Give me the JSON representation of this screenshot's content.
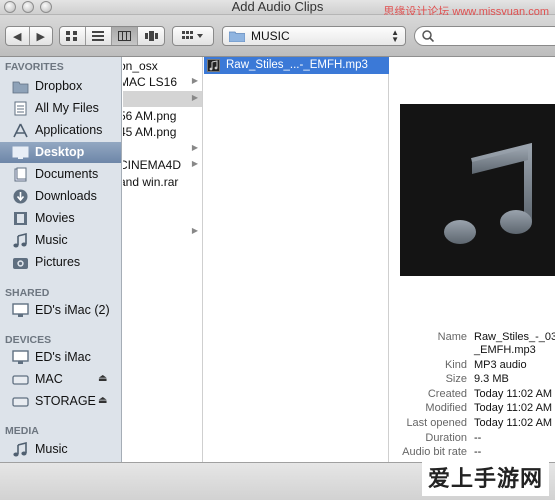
{
  "window": {
    "title": "Add Audio Clips",
    "watermark_top": "思缘设计论坛 www.missyuan.com"
  },
  "toolbar": {
    "back_glyph": "◀",
    "forward_glyph": "▶",
    "path_popup_label": "MUSIC",
    "search_placeholder": ""
  },
  "sidebar": {
    "favorites_header": "FAVORITES",
    "favorites": [
      {
        "label": "Dropbox",
        "icon": "folder-icon"
      },
      {
        "label": "All My Files",
        "icon": "all-files-icon"
      },
      {
        "label": "Applications",
        "icon": "applications-icon"
      },
      {
        "label": "Desktop",
        "icon": "desktop-icon",
        "selected": true
      },
      {
        "label": "Documents",
        "icon": "documents-icon"
      },
      {
        "label": "Downloads",
        "icon": "downloads-icon"
      },
      {
        "label": "Movies",
        "icon": "movies-icon"
      },
      {
        "label": "Music",
        "icon": "music-icon"
      },
      {
        "label": "Pictures",
        "icon": "pictures-icon"
      }
    ],
    "shared_header": "SHARED",
    "shared": [
      {
        "label": "ED's iMac (2)",
        "icon": "computer-icon"
      }
    ],
    "devices_header": "DEVICES",
    "devices": [
      {
        "label": "ED's iMac",
        "icon": "computer-icon"
      },
      {
        "label": "MAC",
        "icon": "drive-icon",
        "eject": true
      },
      {
        "label": "STORAGE",
        "icon": "drive-icon",
        "eject": true
      }
    ],
    "media_header": "MEDIA",
    "media": [
      {
        "label": "Music",
        "icon": "music-icon"
      }
    ]
  },
  "column1": {
    "rows": [
      {
        "label": "on_osx",
        "arrow": false
      },
      {
        "label": "MAC LS16",
        "arrow": true
      },
      {
        "label": "",
        "arrow": true,
        "highlighted": true
      },
      {
        "label": "56 AM.png",
        "arrow": false
      },
      {
        "label": "45 AM.png",
        "arrow": false
      },
      {
        "label": "",
        "arrow": true
      },
      {
        "label": "CINEMA4D",
        "arrow": true
      },
      {
        "label": "and win.rar",
        "arrow": false
      }
    ]
  },
  "column2": {
    "selected_file": "Raw_Stiles_...-_EMFH.mp3"
  },
  "preview": {
    "fields": [
      {
        "key": "Name",
        "value": "Raw_Stiles_-_03"
      },
      {
        "key": "",
        "value": "_EMFH.mp3"
      },
      {
        "key": "Kind",
        "value": "MP3 audio"
      },
      {
        "key": "Size",
        "value": "9.3 MB"
      },
      {
        "key": "Created",
        "value": "Today 11:02 AM"
      },
      {
        "key": "Modified",
        "value": "Today 11:02 AM"
      },
      {
        "key": "Last opened",
        "value": "Today 11:02 AM"
      },
      {
        "key": "Duration",
        "value": "--"
      },
      {
        "key": "Audio bit rate",
        "value": "--"
      }
    ]
  },
  "bottom": {
    "ghost_text": "ncel",
    "watermark": "爱上手游网"
  },
  "colors": {
    "selection_blue": "#3b79d7",
    "sidebar_bg": "#dde3ea",
    "sidebar_selection": "#7f95b4"
  }
}
